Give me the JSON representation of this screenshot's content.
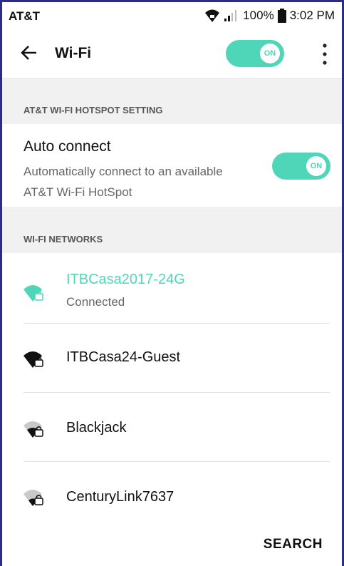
{
  "status_bar": {
    "carrier": "AT&T",
    "battery": "100%",
    "time": "3:02 PM"
  },
  "app_bar": {
    "title": "Wi-Fi",
    "wifi_toggle": {
      "state": "ON"
    }
  },
  "hotspot_section": {
    "header": "AT&T WI-FI HOTSPOT SETTING",
    "auto_connect": {
      "title": "Auto connect",
      "description": "Automatically connect to an available AT&T Wi-Fi HotSpot",
      "toggle_state": "ON"
    }
  },
  "networks_section": {
    "header": "WI-FI NETWORKS",
    "networks": [
      {
        "name": "ITBCasa2017-24G",
        "status": "Connected",
        "color": "#4fd6b8"
      },
      {
        "name": "ITBCasa24-Guest",
        "status": "",
        "color": "#111111"
      },
      {
        "name": "Blackjack",
        "status": "",
        "color": "#111111"
      },
      {
        "name": "CenturyLink7637",
        "status": "",
        "color": "#111111"
      }
    ]
  },
  "footer": {
    "search_label": "SEARCH"
  },
  "colors": {
    "accent": "#4fd6b8",
    "section_bg": "#f1f1f1"
  }
}
